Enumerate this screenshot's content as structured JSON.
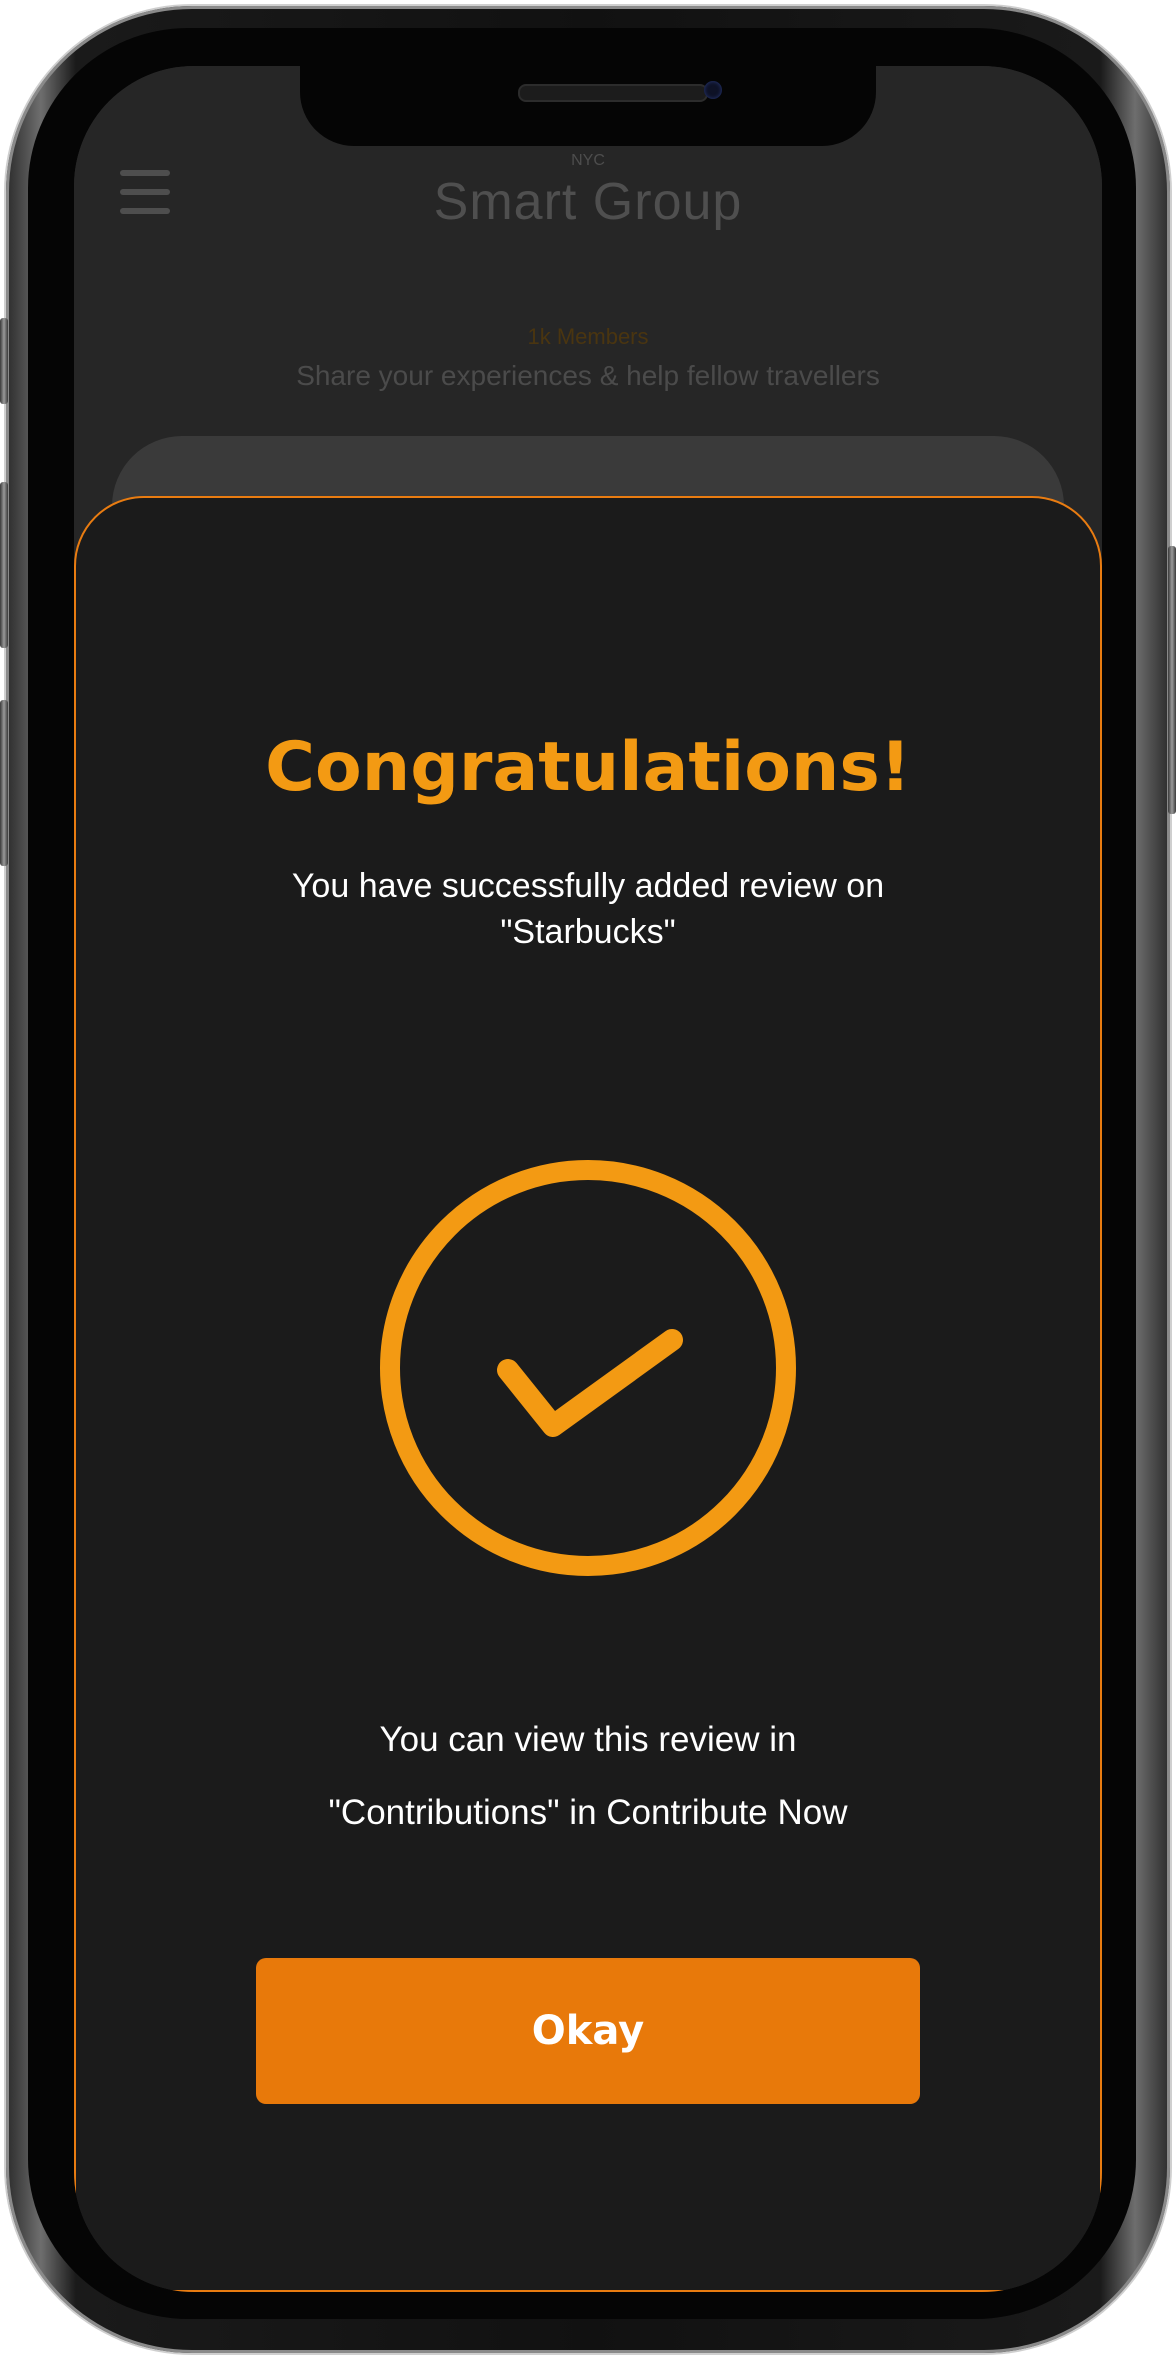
{
  "header": {
    "city": "NYC",
    "title": "Smart Group",
    "members": "1k Members",
    "tagline": "Share your experiences & help fellow travellers"
  },
  "modal": {
    "title": "Congratulations!",
    "subtitle": "You have successfully added review on \"Starbucks\"",
    "note_line1": "You can view this review in",
    "note_line2": "\"Contributions\" in Contribute Now",
    "button_label": "Okay",
    "icon": "check-circle-icon"
  },
  "colors": {
    "accent": "#f39a13",
    "button": "#e8790a",
    "modal_bg": "#1b1b1b",
    "border": "#e97c11"
  }
}
